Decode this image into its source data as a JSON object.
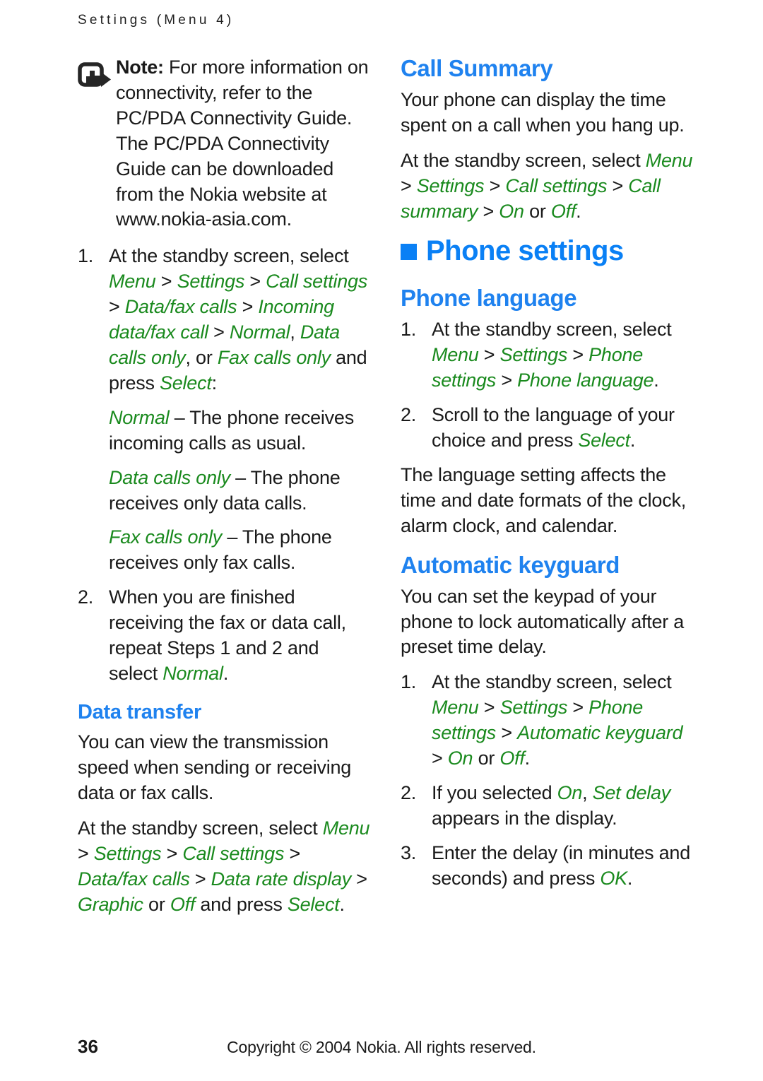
{
  "running_header": "Settings (Menu 4)",
  "note": {
    "icon": "note-pointer-icon",
    "label": "Note:",
    "text": " For more information on connectivity, refer to the PC/PDA Connectivity Guide. The PC/PDA Connectivity Guide can be downloaded from the Nokia website at www.nokia-asia.com."
  },
  "left_column": {
    "step1": {
      "number": "1.",
      "lead": "At the standby screen, select ",
      "path": [
        {
          "t": "Menu",
          "ui": true
        },
        {
          "t": " > ",
          "ui": false
        },
        {
          "t": "Settings",
          "ui": true
        },
        {
          "t": " > ",
          "ui": false
        },
        {
          "t": "Call settings",
          "ui": true
        },
        {
          "t": " > ",
          "ui": false
        },
        {
          "t": "Data/fax calls",
          "ui": true
        },
        {
          "t": " > ",
          "ui": false
        },
        {
          "t": "Incoming data/fax call",
          "ui": true
        },
        {
          "t": " > ",
          "ui": false
        },
        {
          "t": "Normal",
          "ui": true
        },
        {
          "t": ", ",
          "ui": false
        },
        {
          "t": "Data calls only",
          "ui": true
        },
        {
          "t": ", or ",
          "ui": false
        },
        {
          "t": "Fax calls only",
          "ui": true
        },
        {
          "t": " and press ",
          "ui": false
        },
        {
          "t": "Select",
          "ui": true
        },
        {
          "t": ":",
          "ui": false
        }
      ]
    },
    "def_normal": {
      "term": "Normal",
      "body": " – The phone receives incoming calls as usual."
    },
    "def_data": {
      "term": "Data calls only",
      "body": " – The phone receives only data calls."
    },
    "def_fax": {
      "term": "Fax calls only",
      "body": " – The phone receives only fax calls."
    },
    "step2": {
      "number": "2.",
      "lead": "When you are finished receiving the fax or data call, repeat Steps 1 and 2 and select ",
      "term": "Normal",
      "tail": "."
    },
    "data_transfer": {
      "heading": "Data transfer",
      "para": "You can view the transmission speed when sending or receiving data or fax calls.",
      "path_lead": "At the standby screen, select ",
      "path": [
        {
          "t": "Menu",
          "ui": true
        },
        {
          "t": " > ",
          "ui": false
        },
        {
          "t": "Settings",
          "ui": true
        },
        {
          "t": " > ",
          "ui": false
        },
        {
          "t": "Call settings",
          "ui": true
        },
        {
          "t": " > ",
          "ui": false
        },
        {
          "t": "Data/fax calls",
          "ui": true
        },
        {
          "t": " > ",
          "ui": false
        },
        {
          "t": "Data rate display",
          "ui": true
        },
        {
          "t": " > ",
          "ui": false
        },
        {
          "t": "Graphic",
          "ui": true
        },
        {
          "t": " or ",
          "ui": false
        },
        {
          "t": "Off",
          "ui": true
        },
        {
          "t": " and press ",
          "ui": false
        },
        {
          "t": "Select",
          "ui": true
        },
        {
          "t": ".",
          "ui": false
        }
      ]
    }
  },
  "right_column": {
    "call_summary": {
      "heading": "Call Summary",
      "para": "Your phone can display the time spent on a call when you hang up.",
      "path_lead": "At the standby screen, select ",
      "path": [
        {
          "t": "Menu",
          "ui": true
        },
        {
          "t": " > ",
          "ui": false
        },
        {
          "t": "Settings",
          "ui": true
        },
        {
          "t": " > ",
          "ui": false
        },
        {
          "t": "Call settings",
          "ui": true
        },
        {
          "t": " > ",
          "ui": false
        },
        {
          "t": "Call summary",
          "ui": true
        },
        {
          "t": " > ",
          "ui": false
        },
        {
          "t": "On",
          "ui": true
        },
        {
          "t": " or ",
          "ui": false
        },
        {
          "t": "Off",
          "ui": true
        },
        {
          "t": ".",
          "ui": false
        }
      ]
    },
    "chapter": {
      "bullet": "blue-square-bullet",
      "title": "Phone settings"
    },
    "phone_language": {
      "heading": "Phone language",
      "step1": {
        "number": "1.",
        "lead": "At the standby screen, select ",
        "path": [
          {
            "t": "Menu",
            "ui": true
          },
          {
            "t": " > ",
            "ui": false
          },
          {
            "t": "Settings",
            "ui": true
          },
          {
            "t": " > ",
            "ui": false
          },
          {
            "t": "Phone settings",
            "ui": true
          },
          {
            "t": " > ",
            "ui": false
          },
          {
            "t": "Phone language",
            "ui": true
          },
          {
            "t": ".",
            "ui": false
          }
        ]
      },
      "step2": {
        "number": "2.",
        "lead": "Scroll to the language of your choice and press ",
        "term": "Select",
        "tail": "."
      },
      "para": "The language setting affects the time and date formats of the clock, alarm clock, and calendar."
    },
    "automatic_keyguard": {
      "heading": "Automatic keyguard",
      "para": "You can set the keypad of your phone to lock automatically after a preset time delay.",
      "step1": {
        "number": "1.",
        "lead": "At the standby screen, select ",
        "path": [
          {
            "t": "Menu",
            "ui": true
          },
          {
            "t": " > ",
            "ui": false
          },
          {
            "t": "Settings",
            "ui": true
          },
          {
            "t": " > ",
            "ui": false
          },
          {
            "t": "Phone settings",
            "ui": true
          },
          {
            "t": " > ",
            "ui": false
          },
          {
            "t": "Automatic keyguard",
            "ui": true
          },
          {
            "t": " > ",
            "ui": false
          },
          {
            "t": "On",
            "ui": true
          },
          {
            "t": " or ",
            "ui": false
          },
          {
            "t": "Off",
            "ui": true
          },
          {
            "t": ".",
            "ui": false
          }
        ]
      },
      "step2": {
        "number": "2.",
        "lead": "If you selected ",
        "term1": "On",
        "mid": ", ",
        "term2": "Set delay",
        "tail": " appears in the display."
      },
      "step3": {
        "number": "3.",
        "lead": "Enter the delay (in minutes and seconds) and press ",
        "term": "OK",
        "tail": "."
      }
    }
  },
  "footer": {
    "page_number": "36",
    "copyright": "Copyright © 2004 Nokia. All rights reserved."
  },
  "colors": {
    "heading_blue": "#1f82ef",
    "chapter_blue": "#0a80f5",
    "ui_green": "#1a8a1e",
    "body_black": "#1a1a1a"
  }
}
